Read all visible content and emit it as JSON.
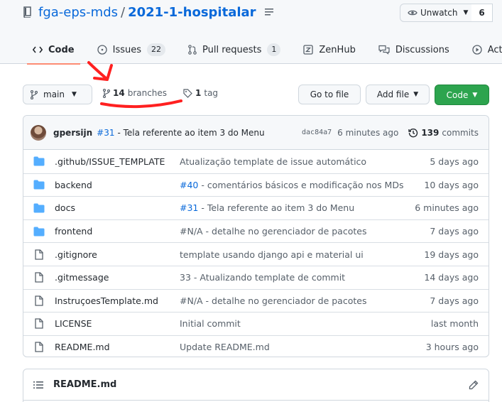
{
  "repo": {
    "owner": "fga-eps-mds",
    "separator": "/",
    "name": "2021-1-hospitalar",
    "watch_label": "Unwatch",
    "watch_count": "6"
  },
  "tabs": [
    {
      "label": "Code",
      "icon": "code-icon",
      "active": true
    },
    {
      "label": "Issues",
      "icon": "issue-icon",
      "count": "22"
    },
    {
      "label": "Pull requests",
      "icon": "pull-request-icon",
      "count": "1"
    },
    {
      "label": "ZenHub",
      "icon": "zenhub-icon"
    },
    {
      "label": "Discussions",
      "icon": "discussions-icon"
    },
    {
      "label": "Actions",
      "icon": "play-icon"
    }
  ],
  "toolbar": {
    "branch": "main",
    "branches_count": "14",
    "branches_label": "branches",
    "tags_count": "1",
    "tags_label": "tag",
    "goto_file": "Go to file",
    "add_file": "Add file",
    "code": "Code"
  },
  "commit": {
    "author": "gpersijn",
    "ref": "#31",
    "message": "- Tela referente ao item 3 do Menu",
    "sha": "dac84a7",
    "time": "6 minutes ago",
    "count": "139",
    "count_label": "commits"
  },
  "files": [
    {
      "type": "dir",
      "name": ".github/ISSUE_TEMPLATE",
      "ref": "",
      "message": "Atualização template de issue automático",
      "age": "5 days ago"
    },
    {
      "type": "dir",
      "name": "backend",
      "ref": "#40",
      "message": " - comentários básicos e modificação nos MDs",
      "age": "10 days ago"
    },
    {
      "type": "dir",
      "name": "docs",
      "ref": "#31",
      "message": " - Tela referente ao item 3 do Menu",
      "age": "6 minutes ago"
    },
    {
      "type": "dir",
      "name": "frontend",
      "ref": "",
      "message": "#N/A - detalhe no gerenciador de pacotes",
      "age": "7 days ago"
    },
    {
      "type": "file",
      "name": ".gitignore",
      "ref": "",
      "message": "template usando django api e material ui",
      "age": "19 days ago"
    },
    {
      "type": "file",
      "name": ".gitmessage",
      "ref": "",
      "message": "33 - Atualizando template de commit",
      "age": "14 days ago"
    },
    {
      "type": "file",
      "name": "InstruçoesTemplate.md",
      "ref": "",
      "message": "#N/A - detalhe no gerenciador de pacotes",
      "age": "7 days ago"
    },
    {
      "type": "file",
      "name": "LICENSE",
      "ref": "",
      "message": "Initial commit",
      "age": "last month"
    },
    {
      "type": "file",
      "name": "README.md",
      "ref": "",
      "message": "Update README.md",
      "age": "3 hours ago"
    }
  ],
  "readme": {
    "title": "README.md"
  },
  "colors": {
    "link": "#0969da",
    "folder": "#54aeff",
    "primary_button": "#2da44e",
    "annotation": "#ff2020"
  }
}
